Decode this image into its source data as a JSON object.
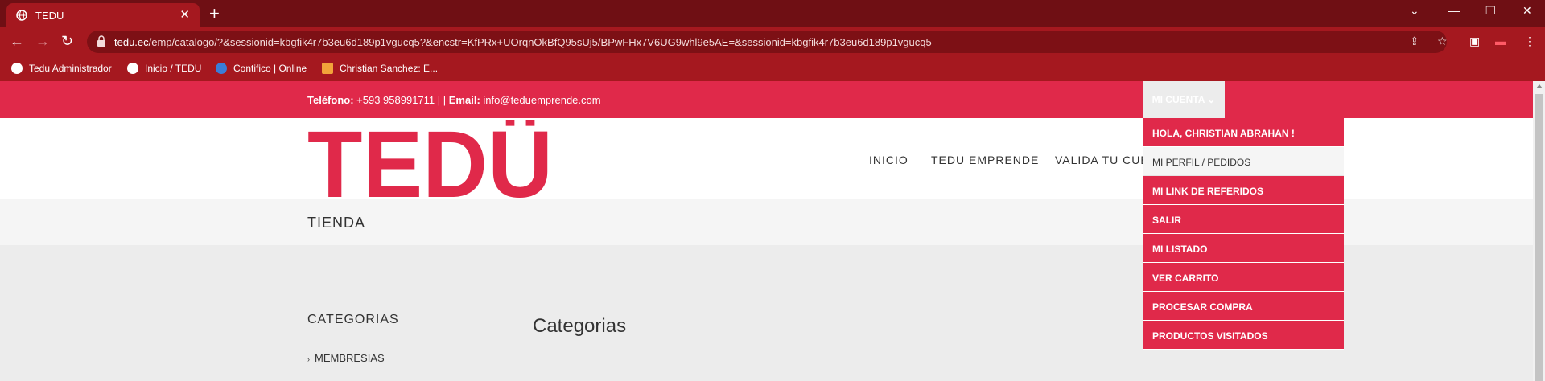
{
  "browser": {
    "tab_title": "TEDU",
    "tab_close": "✕",
    "new_tab": "+",
    "url_domain": "tedu.ec",
    "url_rest": "/emp/catalogo/?&sessionid=kbgfik4r7b3eu6d189p1vgucq5?&encstr=KfPRx+UOrqnOkBfQ95sUj5/BPwFHx7V6UG9whl9e5AE=&sessionid=kbgfik4r7b3eu6d189p1vgucq5",
    "bookmarks": [
      "Tedu Administrador",
      "Inicio / TEDU",
      "Contifico | Online",
      "Christian Sanchez: E..."
    ]
  },
  "topbar": {
    "phone_label": "Teléfono:",
    "phone": "+593 958991711 | |",
    "email_label": "Email:",
    "email": "info@teduemprende.com",
    "account_label": "MI CUENTA ⌄"
  },
  "logo_text": "TEDÜ",
  "nav": [
    "INICIO",
    "TEDU EMPRENDE",
    "VALIDA TU CUE"
  ],
  "page_title": "TIENDA",
  "sidebar": {
    "title": "CATEGORIAS",
    "items": [
      "MEMBRESIAS"
    ]
  },
  "main_title": "Categorias",
  "account_menu": [
    "HOLA, CHRISTIAN ABRAHAN !",
    "MI PERFIL / PEDIDOS",
    "MI LINK DE REFERIDOS",
    "SALIR",
    "MI LISTADO",
    "VER CARRITO",
    "PROCESAR COMPRA",
    "PRODUCTOS VISITADOS"
  ],
  "colors": {
    "brand": "#e0294a",
    "chrome": "#a5181f",
    "chrome_dark": "#6f0f14"
  }
}
